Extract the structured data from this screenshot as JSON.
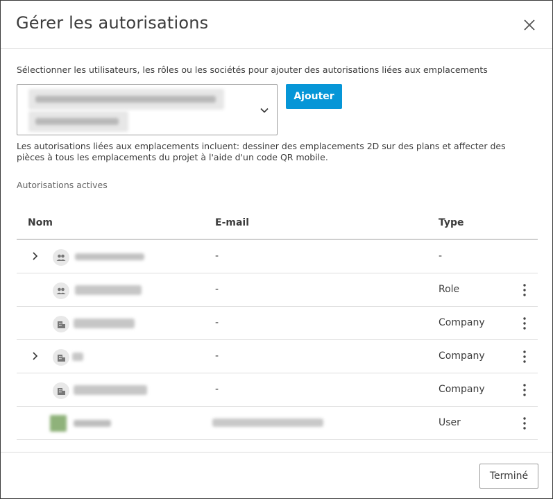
{
  "dialog": {
    "title": "Gérer les autorisations",
    "close_icon": "close-icon"
  },
  "form": {
    "instruction": "Sélectionner les utilisateurs, les rôles ou les sociétés pour ajouter des autorisations liées aux emplacements",
    "add_label": "Ajouter",
    "info": "Les autorisations liées aux emplacements incluent: dessiner des emplacements 2D sur des plans et affecter des pièces à tous les emplacements du projet à l'aide d'un code QR mobile."
  },
  "table": {
    "section_label": "Autorisations actives",
    "headers": {
      "name": "Nom",
      "email": "E-mail",
      "type": "Type"
    },
    "rows": [
      {
        "email": "-",
        "type": "-",
        "icon": "group-icon"
      },
      {
        "email": "-",
        "type": "Role",
        "icon": "group-icon"
      },
      {
        "email": "-",
        "type": "Company",
        "icon": "company-icon"
      },
      {
        "email": "-",
        "type": "Company",
        "icon": "company-icon"
      },
      {
        "email": "-",
        "type": "Company",
        "icon": "company-icon"
      },
      {
        "email": "",
        "type": "User",
        "icon": "user-avatar"
      }
    ]
  },
  "footer": {
    "done_label": "Terminé"
  },
  "colors": {
    "primary": "#0696d7",
    "border": "#9a9a9a",
    "text": "#3c3c3c"
  }
}
